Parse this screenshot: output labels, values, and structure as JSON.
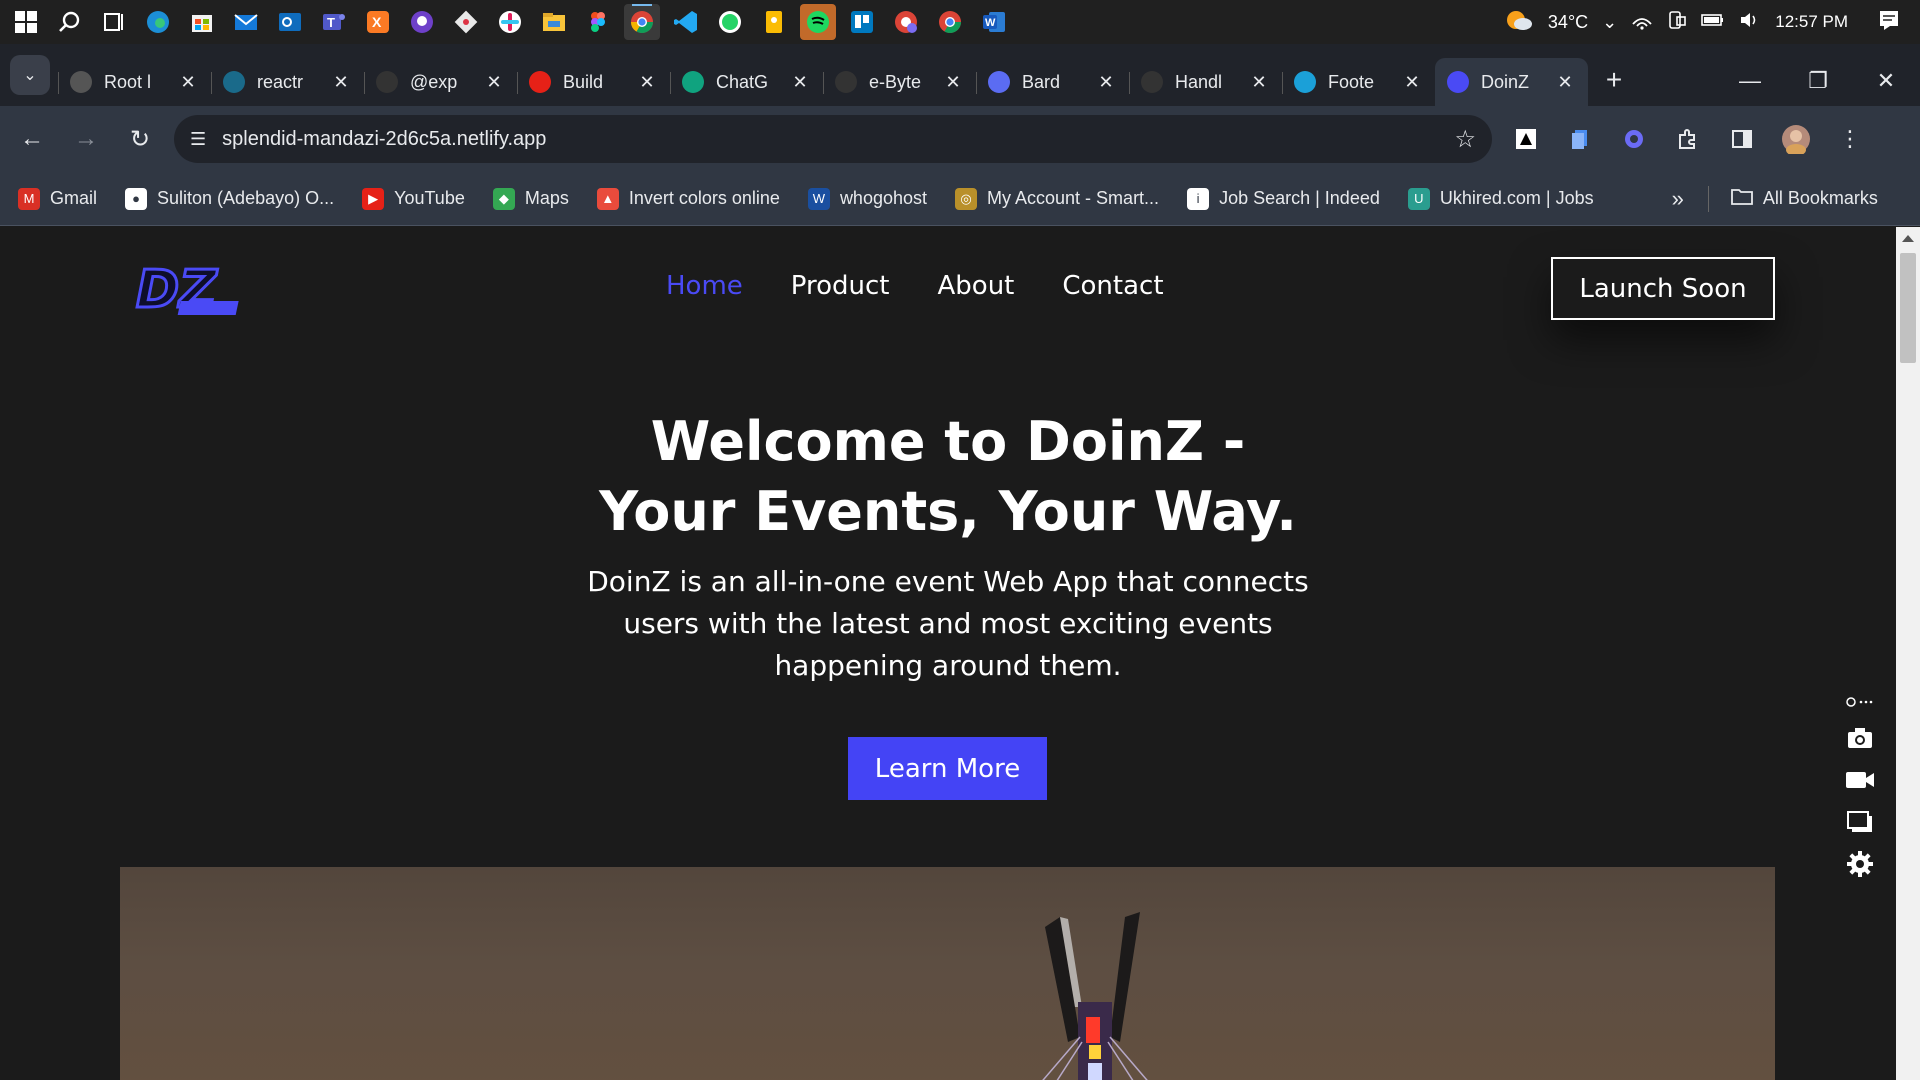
{
  "taskbar": {
    "weather": "34°C",
    "time": "12:57 PM"
  },
  "tabs": [
    {
      "title": "Root l",
      "color": "#555"
    },
    {
      "title": "reactr",
      "color": "#1a6a8a"
    },
    {
      "title": "@exp",
      "color": "#333"
    },
    {
      "title": "Build",
      "color": "#e62117"
    },
    {
      "title": "ChatG",
      "color": "#10a37f"
    },
    {
      "title": "e-Byte",
      "color": "#333"
    },
    {
      "title": "Bard",
      "color": "#5b6cf2"
    },
    {
      "title": "Handl",
      "color": "#333"
    },
    {
      "title": "Foote",
      "color": "#1ba0d8"
    },
    {
      "title": "DoinZ",
      "color": "#4a4af5"
    }
  ],
  "toolbar": {
    "url": "splendid-mandazi-2d6c5a.netlify.app"
  },
  "bookmarks": [
    {
      "label": "Gmail",
      "color": "#d93025",
      "glyph": "M"
    },
    {
      "label": "Suliton (Adebayo) O...",
      "color": "#ffffff",
      "glyph": "●"
    },
    {
      "label": "YouTube",
      "color": "#e62117",
      "glyph": "▶"
    },
    {
      "label": "Maps",
      "color": "#34a853",
      "glyph": "◆"
    },
    {
      "label": "Invert colors online",
      "color": "#e94b3c",
      "glyph": "▲"
    },
    {
      "label": "whogohost",
      "color": "#1a4fa0",
      "glyph": "W"
    },
    {
      "label": "My Account - Smart...",
      "color": "#b9902a",
      "glyph": "◎"
    },
    {
      "label": "Job Search | Indeed",
      "color": "#ffffff",
      "glyph": "i"
    },
    {
      "label": "Ukhired.com | Jobs",
      "color": "#2a9d8f",
      "glyph": "U"
    }
  ],
  "bookmarks_all": "All Bookmarks",
  "site": {
    "logo_text": "DZ",
    "nav": [
      "Home",
      "Product",
      "About",
      "Contact"
    ],
    "launch_label": "Launch Soon",
    "hero_title_line1": "Welcome to DoinZ -",
    "hero_title_line2": "Your Events, Your Way.",
    "hero_sub": "DoinZ is an all-in-one event Web App that connects users with the latest and most exciting events happening around them.",
    "learn_label": "Learn More",
    "accent": "#4444f5"
  }
}
